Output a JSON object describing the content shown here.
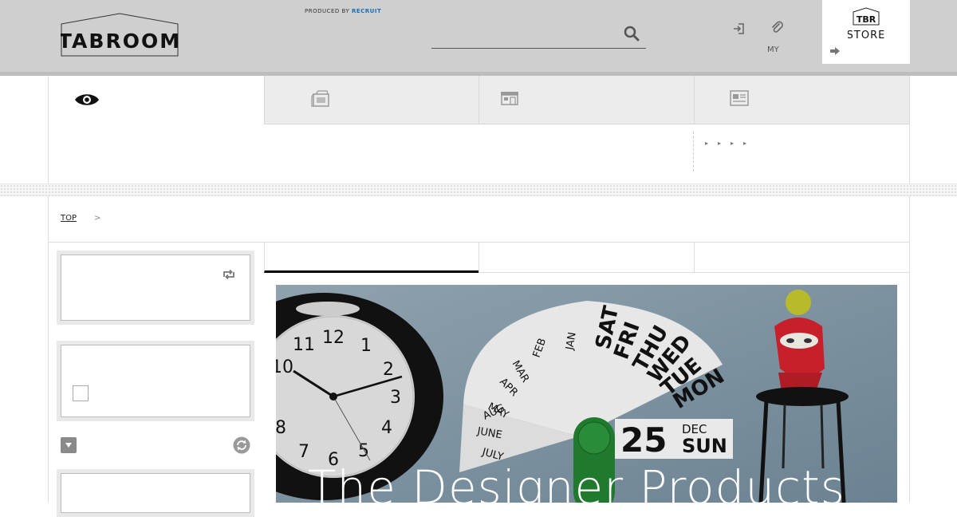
{
  "header": {
    "logo_text": "TABROOM",
    "produced_by_label": "PRODUCED BY",
    "produced_by_brand": "RECRUIT",
    "search": {
      "placeholder": "",
      "value": ""
    },
    "my_label": "MY",
    "store_logo_text": "TBR",
    "store_label": "STORE",
    "icons": {
      "search": "search-icon",
      "login": "login-icon",
      "clip": "paperclip-icon",
      "store_arrow": "arrow-right-icon"
    },
    "colors": {
      "header_bg": "#cfcfcf",
      "brand_blue": "#1a6fb5"
    }
  },
  "nav": {
    "icons": [
      "eye-icon",
      "newspaper-icon",
      "shop-icon",
      "article-icon"
    ]
  },
  "breadcrumb": {
    "top_label": "TOP",
    "separator": ">"
  },
  "hero": {
    "title": "The Designer Products",
    "clock_numbers": [
      "12",
      "1",
      "2",
      "3",
      "4",
      "5",
      "6",
      "7",
      "8",
      "10",
      "11"
    ],
    "calendar": {
      "months": [
        "JAN",
        "FEB",
        "MAR",
        "APR",
        "MAY",
        "JUNE",
        "JULY",
        "AUG"
      ],
      "weekdays": [
        "SAT",
        "FRI",
        "THU",
        "WED",
        "TUE",
        "MON"
      ],
      "day": "25",
      "month": "DEC",
      "weekday": "SUN"
    }
  }
}
